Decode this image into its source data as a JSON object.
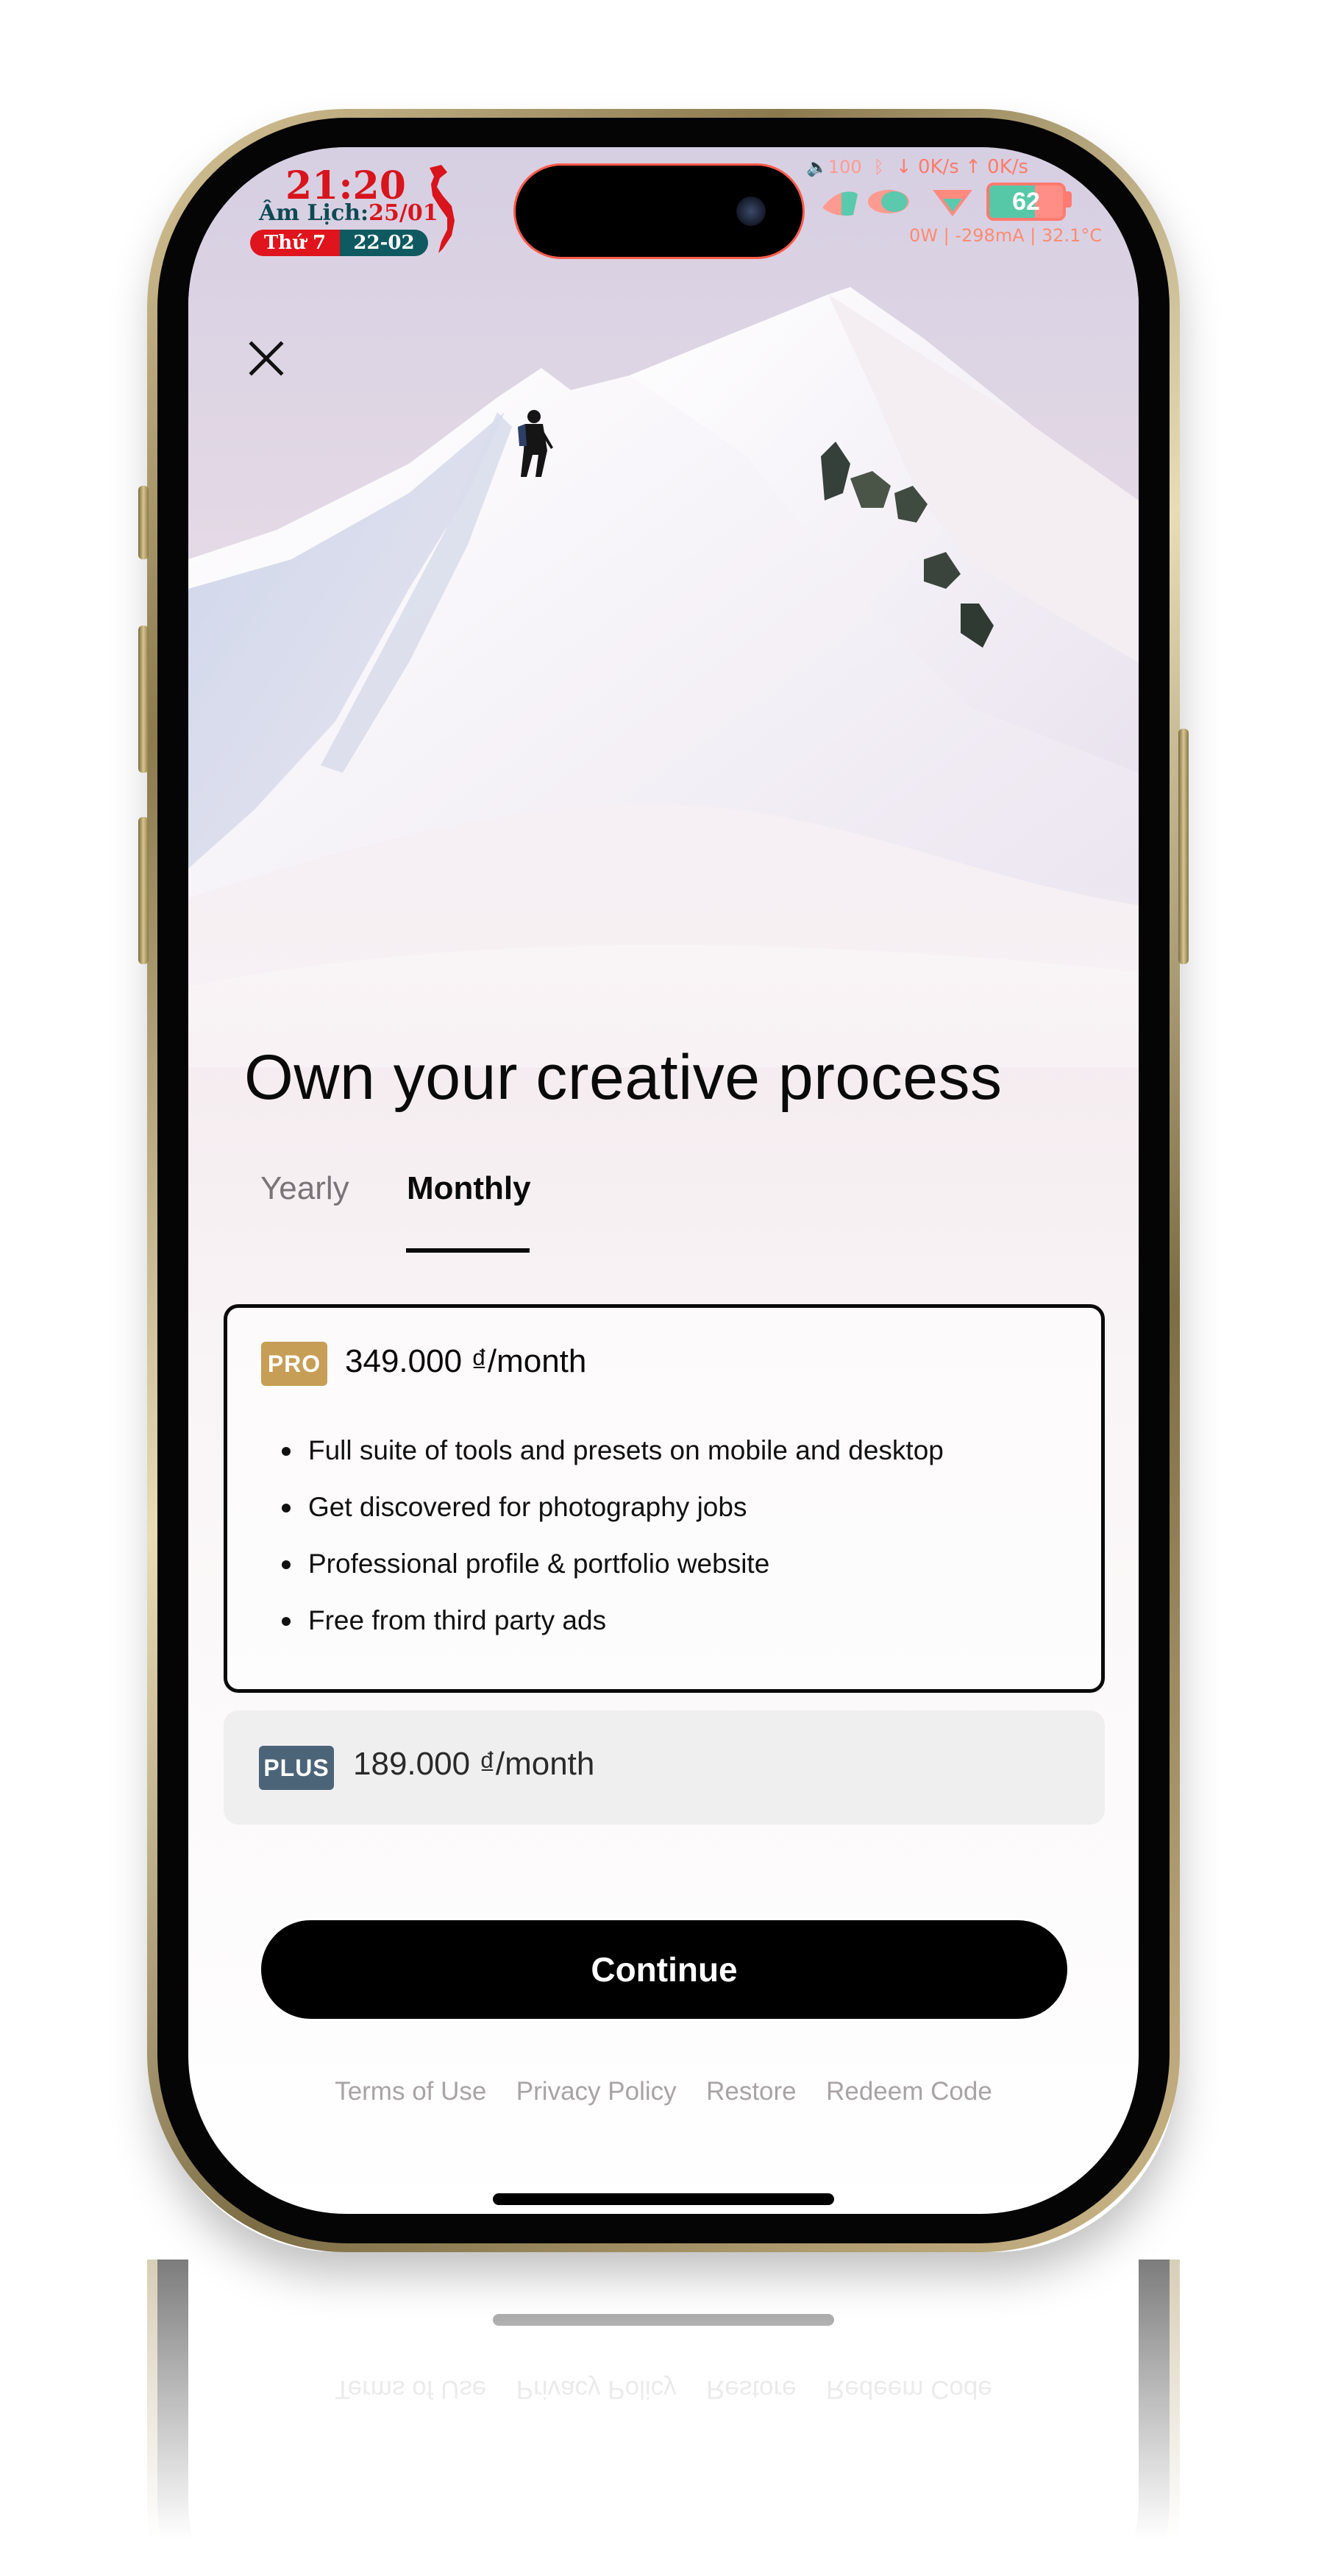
{
  "status_bar": {
    "time": "21:20",
    "lunar_label": "Âm Lịch:",
    "lunar_date": "25/01",
    "weekday": "Thứ 7",
    "solar_date": "22-02",
    "volume": "100",
    "download_speed": "↓ 0K/s",
    "upload_speed": "↑ 0K/s",
    "battery_level": "62",
    "power_info": "0W | -298mA | 32.1°C",
    "accent_colors": {
      "red": "#d8141c",
      "teal": "#0f5a60",
      "coral": "#ff7a6a"
    }
  },
  "close_icon": "close-icon",
  "title": "Own your creative process",
  "billing_tabs": [
    {
      "label": "Yearly",
      "selected": false
    },
    {
      "label": "Monthly",
      "selected": true
    }
  ],
  "plans": {
    "pro": {
      "badge": "PRO",
      "badge_color": "#c79e56",
      "price": "349.000 ₫/month",
      "selected": true,
      "features": [
        "Full suite of tools and presets on mobile and desktop",
        "Get discovered for photography jobs",
        "Professional profile & portfolio website",
        "Free from third party ads"
      ]
    },
    "plus": {
      "badge": "PLUS",
      "badge_color": "#4b6478",
      "price": "189.000 ₫/month",
      "selected": false
    }
  },
  "continue_label": "Continue",
  "footer_links": [
    "Terms of Use",
    "Privacy Policy",
    "Restore",
    "Redeem Code"
  ]
}
